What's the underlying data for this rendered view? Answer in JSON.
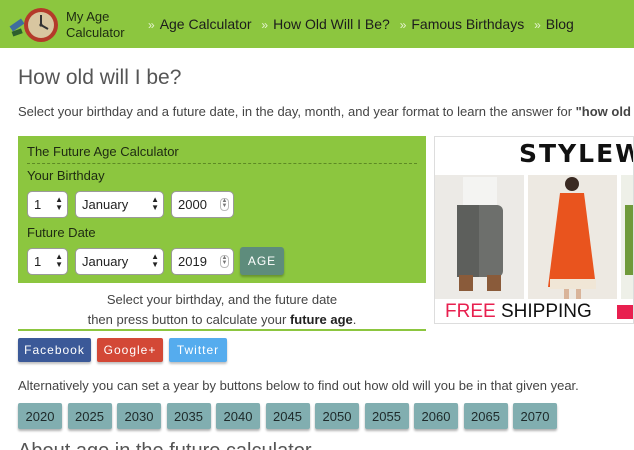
{
  "header": {
    "logo_text_line1": "My Age",
    "logo_text_line2": "Calculator",
    "nav": [
      {
        "label": "Age Calculator"
      },
      {
        "label": "How Old Will I Be?"
      },
      {
        "label": "Famous Birthdays"
      },
      {
        "label": "Blog"
      }
    ],
    "nav_separator": "»"
  },
  "page": {
    "title": "How old will I be?",
    "intro": "Select your birthday and a future date, in the day, month, and year format to learn the answer for ",
    "intro_bold": "\"how old"
  },
  "calculator": {
    "title": "The Future Age Calculator",
    "birthday_label": "Your Birthday",
    "birthday": {
      "day": "1",
      "month": "January",
      "year": "2000"
    },
    "future_label": "Future Date",
    "future": {
      "day": "1",
      "month": "January",
      "year": "2019"
    },
    "button_label": "AGE"
  },
  "hint": {
    "line1": "Select your birthday, and the future date",
    "line2": "then press button to calculate your ",
    "line2_bold": "future age",
    "line2_end": "."
  },
  "social": [
    {
      "label": "Facebook",
      "color": "#3b5998"
    },
    {
      "label": "Google+",
      "color": "#d34836"
    },
    {
      "label": "Twitter",
      "color": "#55acee"
    }
  ],
  "alternative_text": "Alternatively you can set a year by buttons below to find out how old will you be in that given year.",
  "year_buttons": [
    "2020",
    "2025",
    "2030",
    "2035",
    "2040",
    "2045",
    "2050",
    "2055",
    "2060",
    "2065",
    "2070"
  ],
  "section_title": "About age in the future calculator",
  "ad": {
    "brand": "STYLEWE",
    "free": "FREE",
    "shipping": "SHIPPING"
  },
  "colors": {
    "brand_green": "#8cc63f",
    "age_button": "#5e8c7c",
    "year_button": "#81aeb0",
    "ad_pink": "#e8204f"
  }
}
